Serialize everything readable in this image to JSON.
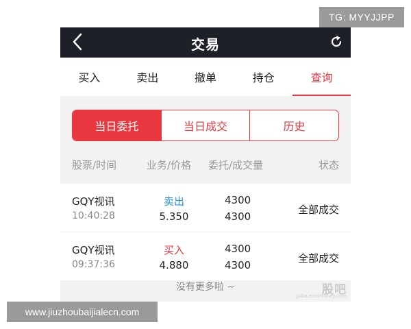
{
  "header": {
    "title": "交易",
    "back_icon": "chevron-left-icon",
    "refresh_icon": "refresh-icon"
  },
  "tabs": [
    {
      "label": "买入",
      "active": false
    },
    {
      "label": "卖出",
      "active": false
    },
    {
      "label": "撤单",
      "active": false
    },
    {
      "label": "持仓",
      "active": false
    },
    {
      "label": "查询",
      "active": true
    }
  ],
  "segments": [
    {
      "label": "当日委托",
      "active": true
    },
    {
      "label": "当日成交",
      "active": false
    },
    {
      "label": "历史",
      "active": false
    }
  ],
  "columns": {
    "stock_time": "股票/时间",
    "action_price": "业务/价格",
    "order_filled": "委托/成交量",
    "status": "状态"
  },
  "orders": [
    {
      "name": "GQY视讯",
      "time": "10:40:28",
      "action": "卖出",
      "action_type": "sell",
      "price": "5.350",
      "order_qty": "4300",
      "filled_qty": "4300",
      "status": "全部成交"
    },
    {
      "name": "GQY视讯",
      "time": "09:37:36",
      "action": "买入",
      "action_type": "buy",
      "price": "4.880",
      "order_qty": "4300",
      "filled_qty": "4300",
      "status": "全部成交"
    }
  ],
  "footer": {
    "no_more": "没有更多啦 ~",
    "watermark_logo": "股吧",
    "watermark_sub": "guba.eastmoney.com"
  },
  "overlays": {
    "tg_badge": "TG: MYYJJPP",
    "url_badge": "www.jiuzhoubaijialecn.com"
  },
  "colors": {
    "accent": "#e8373f",
    "sell": "#2a8fc8",
    "titlebar": "#1d2026"
  }
}
